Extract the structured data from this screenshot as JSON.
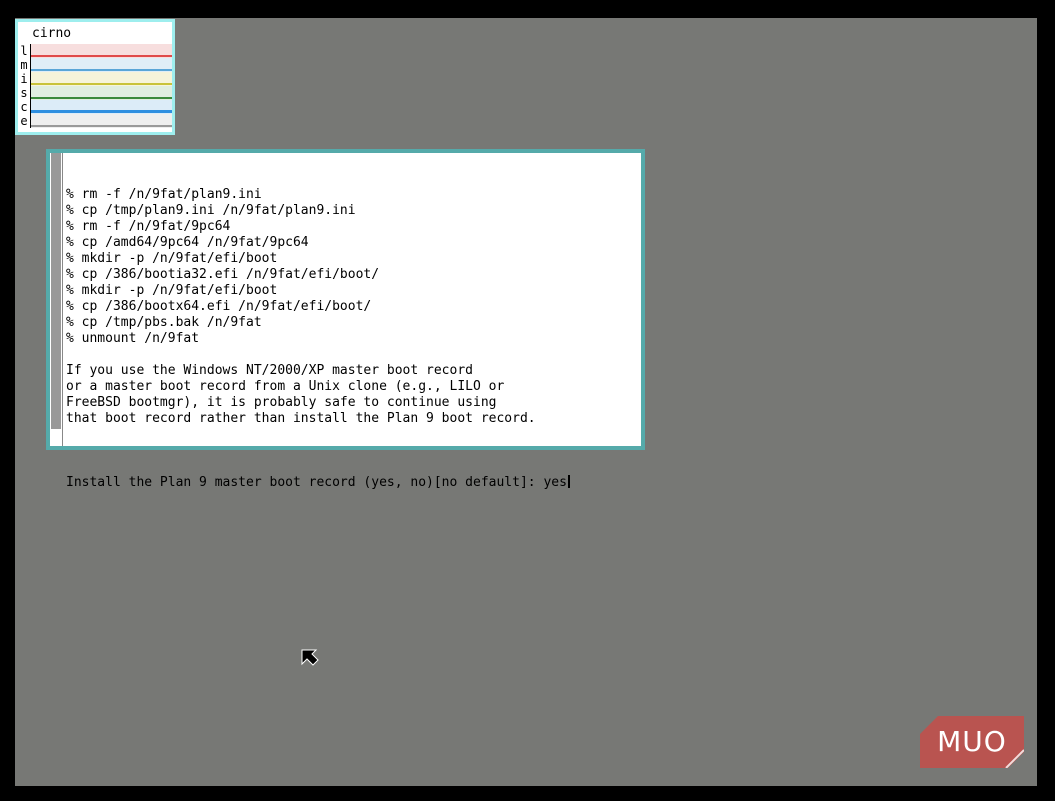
{
  "stats": {
    "title": "cirno",
    "rows": [
      {
        "letter": "l",
        "color": "#e04a4a",
        "bg": "#f7dede"
      },
      {
        "letter": "m",
        "color": "#5aa6d8",
        "bg": "#e0eef7"
      },
      {
        "letter": "i",
        "color": "#c9c33a",
        "bg": "#f6f4da"
      },
      {
        "letter": "s",
        "color": "#3b8a3b",
        "bg": "#e0eee0"
      },
      {
        "letter": "c",
        "color": "#2f8fe0",
        "bg": "#dcecf8"
      },
      {
        "letter": "e",
        "color": "#999999",
        "bg": "#eeeeee"
      }
    ]
  },
  "terminal": {
    "lines": [
      "% rm -f /n/9fat/plan9.ini",
      "% cp /tmp/plan9.ini /n/9fat/plan9.ini",
      "% rm -f /n/9fat/9pc64",
      "% cp /amd64/9pc64 /n/9fat/9pc64",
      "% mkdir -p /n/9fat/efi/boot",
      "% cp /386/bootia32.efi /n/9fat/efi/boot/",
      "% mkdir -p /n/9fat/efi/boot",
      "% cp /386/bootx64.efi /n/9fat/efi/boot/",
      "% cp /tmp/pbs.bak /n/9fat",
      "% unmount /n/9fat",
      "",
      "If you use the Windows NT/2000/XP master boot record",
      "or a master boot record from a Unix clone (e.g., LILO or",
      "FreeBSD bootmgr), it is probably safe to continue using",
      "that boot record rather than install the Plan 9 boot record.",
      ""
    ],
    "prompt": "Install the Plan 9 master boot record (yes, no)[no default]: ",
    "input": "yes"
  },
  "logo": {
    "text": "MUO",
    "color": "#c0504d"
  },
  "colors": {
    "desktop": "#777875",
    "window_border": "#55aaaa"
  },
  "icons": {
    "pointer": "arrow-pointer-icon"
  }
}
